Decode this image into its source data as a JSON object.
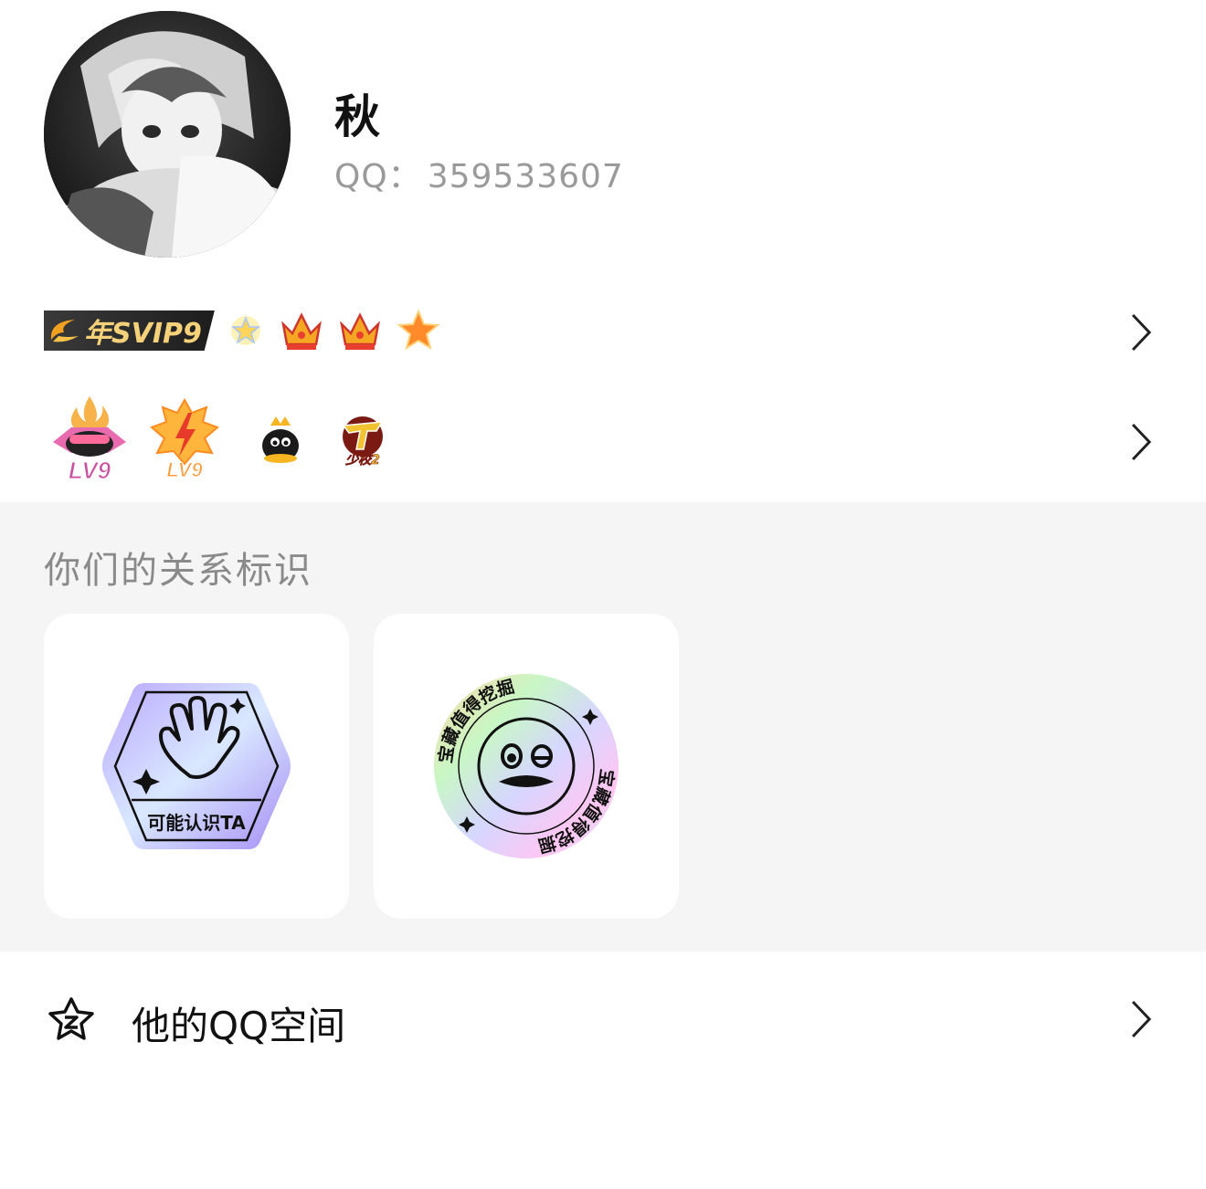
{
  "profile": {
    "nickname": "秋",
    "qq_label": "QQ：",
    "qq_number": "359533607"
  },
  "badges_row1": {
    "svip_label": "年SVIP9",
    "icons": [
      "sun-star-icon",
      "crown-icon",
      "crown-icon",
      "star-icon"
    ]
  },
  "badges_row2": {
    "icons": [
      "fire-penguin-lv9-icon",
      "lightning-lv9-icon",
      "penguin-icon",
      "crossfire-icon"
    ],
    "lv_label_1": "LV9",
    "lv_label_2": "LV9",
    "cf_label": "少校2"
  },
  "relation": {
    "title": "你们的关系标识",
    "cards": [
      {
        "label": "可能认识TA",
        "icon": "waving-hand-icon"
      },
      {
        "ring_text": "宝藏值得挖掘",
        "ring_text_2": "宝藏值得挖掘",
        "icon": "winking-face-icon"
      }
    ]
  },
  "qzone": {
    "label": "他的QQ空间",
    "icon": "qzone-star-icon"
  },
  "colors": {
    "accent_gold": "#f5d27a",
    "muted_text": "#9a9a9a",
    "section_bg": "#f5f5f5"
  }
}
